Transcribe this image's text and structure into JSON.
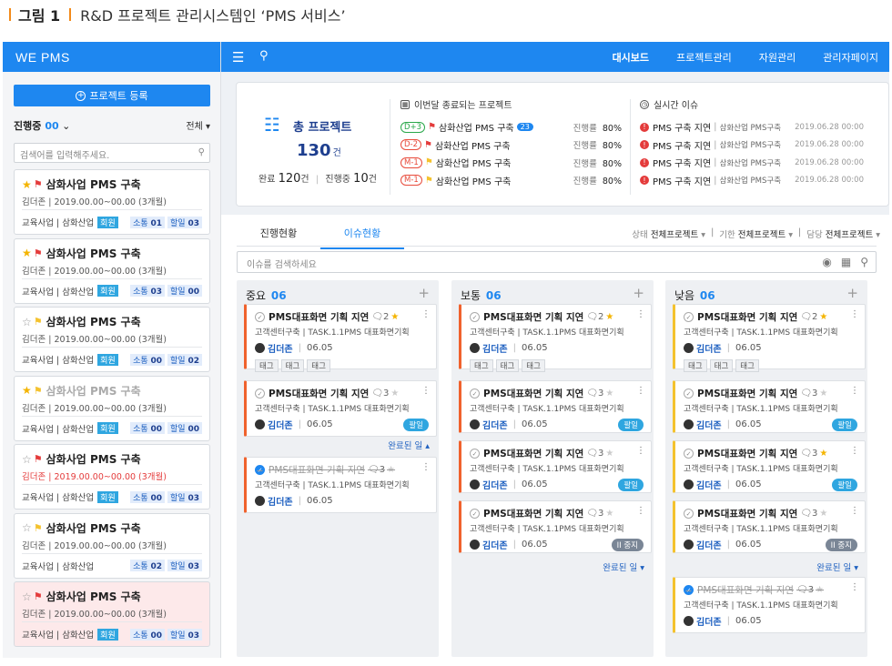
{
  "caption": {
    "figure": "그림 1",
    "title": "R&D 프로젝트 관리시스템인 ‘PMS 서비스’"
  },
  "sidebar": {
    "logo": "WE PMS",
    "register_label": "프로젝트 등록",
    "status_filter": "진행중",
    "status_count": "00",
    "all_filter": "전체",
    "search_placeholder": "검색어를 입력해주세요.",
    "projects": [
      {
        "title": "삼화사업 PMS 구축",
        "owner": "김더존",
        "period": "2019.00.00~00.00 (3개월)",
        "dept": "교육사업 | 삼화산업",
        "member": "회원",
        "comm_label": "소통",
        "comm": "01",
        "tasks_label": "할일",
        "tasks": "03",
        "starred": true,
        "flag": "red"
      },
      {
        "title": "삼화사업 PMS 구축",
        "owner": "김더존",
        "period": "2019.00.00~00.00 (3개월)",
        "dept": "교육사업 | 삼화산업",
        "member": "회원",
        "comm_label": "소통",
        "comm": "03",
        "tasks_label": "할일",
        "tasks": "00",
        "starred": true,
        "flag": "red"
      },
      {
        "title": "삼화사업 PMS 구축",
        "owner": "김더존",
        "period": "2019.00.00~00.00 (3개월)",
        "dept": "교육사업 | 삼화산업",
        "member": "회원",
        "comm_label": "소통",
        "comm": "00",
        "tasks_label": "할일",
        "tasks": "02",
        "starred": false,
        "flag": "yellow"
      },
      {
        "title": "삼화사업 PMS 구축",
        "owner": "김더존",
        "period": "2019.00.00~00.00 (3개월)",
        "dept": "교육사업 | 삼화산업",
        "member": "회원",
        "comm_label": "소통",
        "comm": "00",
        "tasks_label": "할일",
        "tasks": "00",
        "starred": true,
        "flag": "yellow"
      },
      {
        "title": "삼화사업 PMS 구축",
        "owner": "김더존",
        "period": "2019.00.00~00.00 (3개월)",
        "dept": "교육사업 | 삼화산업",
        "member": "회원",
        "comm_label": "소통",
        "comm": "00",
        "tasks_label": "할일",
        "tasks": "03",
        "starred": false,
        "flag": "red"
      },
      {
        "title": "삼화사업 PMS 구축",
        "owner": "김더존",
        "period": "2019.00.00~00.00 (3개월)",
        "dept": "교육사업 | 삼화산업",
        "member": "",
        "comm_label": "소통",
        "comm": "02",
        "tasks_label": "할일",
        "tasks": "03",
        "starred": false,
        "flag": "yellow"
      },
      {
        "title": "삼화사업 PMS 구축",
        "owner": "김더존",
        "period": "2019.00.00~00.00 (3개월)",
        "dept": "교육사업 | 삼화산업",
        "member": "회원",
        "comm_label": "소통",
        "comm": "00",
        "tasks_label": "할일",
        "tasks": "03",
        "starred": false,
        "flag": "red"
      }
    ]
  },
  "topnav": [
    "대시보드",
    "프로젝트관리",
    "자원관리",
    "관리자페이지"
  ],
  "summary": {
    "total_label": "총 프로젝트",
    "total": "130",
    "total_unit": "건",
    "done_label": "완료",
    "done": "120",
    "ongoing_label": "진행중",
    "ongoing": "10",
    "unit": "건",
    "ending_title": "이번달 종료되는 프로젝트",
    "progress_label": "진행률",
    "ending": [
      {
        "dday": "D+3",
        "name": "삼화산업 PMS 구축",
        "badge": "23",
        "pct": "80%"
      },
      {
        "dday": "D-2",
        "name": "삼화산업 PMS 구축",
        "badge": "",
        "pct": "80%"
      },
      {
        "dday": "M-1",
        "name": "삼화산업 PMS 구축",
        "badge": "",
        "pct": "80%"
      },
      {
        "dday": "M-1",
        "name": "삼화산업 PMS 구축",
        "badge": "",
        "pct": "80%"
      }
    ],
    "issues_title": "실시간 이슈",
    "issues": [
      {
        "title": "PMS 구축 지연",
        "proj": "삼화산업 PMS구축",
        "date": "2019.06.28 00:00"
      },
      {
        "title": "PMS 구축 지연",
        "proj": "삼화산업 PMS구축",
        "date": "2019.06.28 00:00"
      },
      {
        "title": "PMS 구축 지연",
        "proj": "삼화산업 PMS구축",
        "date": "2019.06.28 00:00"
      },
      {
        "title": "PMS 구축 지연",
        "proj": "삼화산업 PMS구축",
        "date": "2019.06.28 00:00"
      }
    ]
  },
  "tabs": [
    "진행현황",
    "이슈현황"
  ],
  "filters": {
    "status_label": "상태",
    "status": "전체프로젝트",
    "period_label": "기한",
    "period": "전체프로젝트",
    "owner_label": "담당",
    "owner": "전체프로젝트"
  },
  "issue_search_placeholder": "이슈를 검색하세요",
  "columns": [
    {
      "name": "중요",
      "count": "06",
      "done_label": "완료된 일"
    },
    {
      "name": "보통",
      "count": "06",
      "done_label": "완료된 일"
    },
    {
      "name": "낮음",
      "count": "06",
      "done_label": "완료된 일"
    }
  ],
  "issue_card": {
    "title": "PMS대표화면 기획 지연",
    "sub": "고객센터구축 | TASK.1.1PMS 대표화면기획",
    "who": "김더존",
    "date": "06.05",
    "tag": "태그"
  },
  "status_labels": {
    "progress": "진행중",
    "hold": "팔일",
    "stop": "중지"
  }
}
